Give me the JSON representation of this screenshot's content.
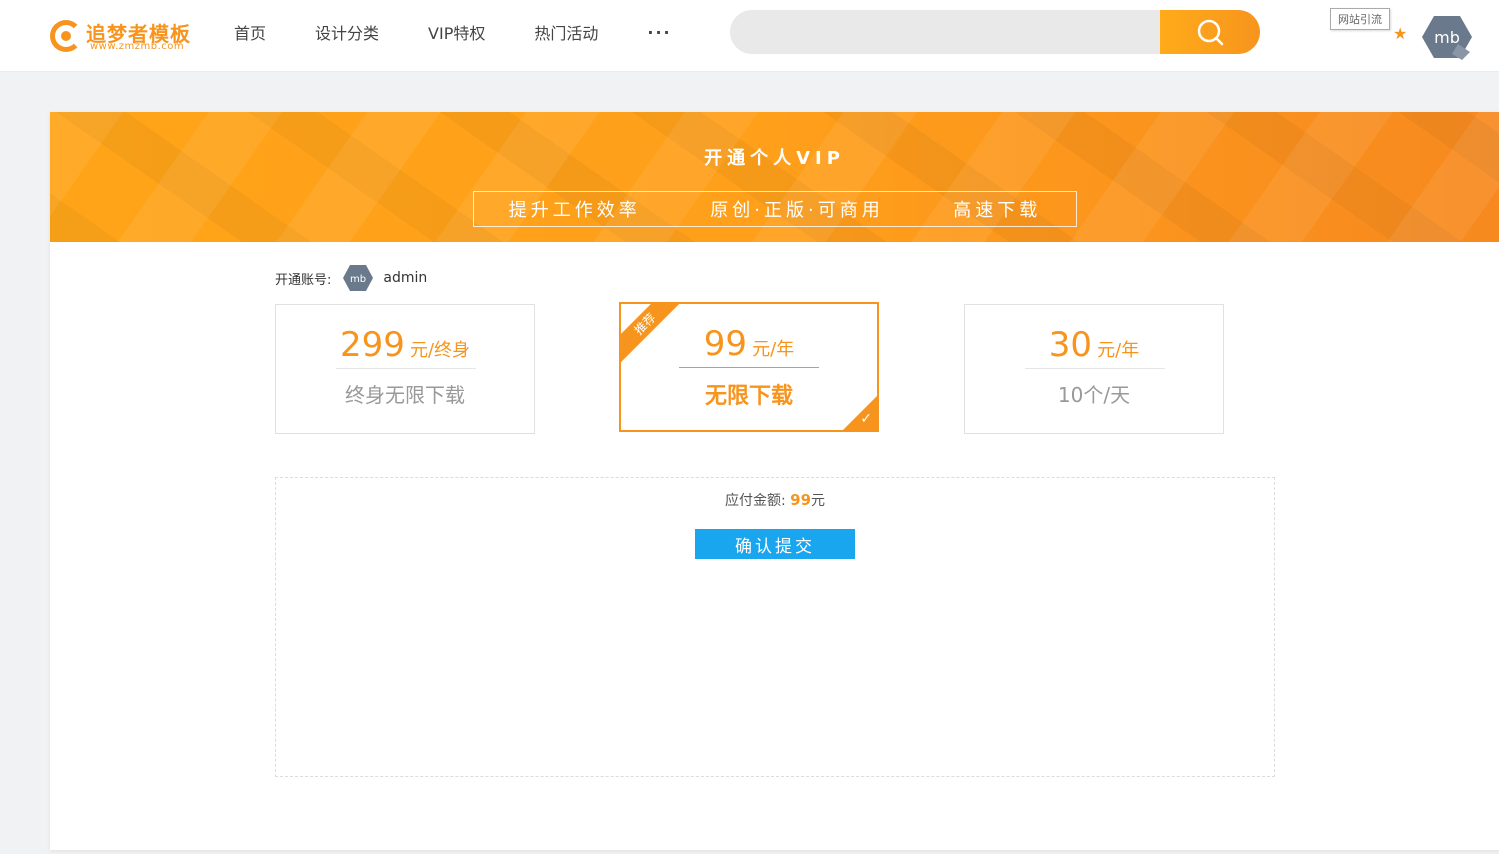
{
  "header": {
    "logo": {
      "name": "追梦者模板",
      "domain": "www.zmzmb.com"
    },
    "nav": [
      {
        "label": "首页"
      },
      {
        "label": "设计分类"
      },
      {
        "label": "VIP特权"
      },
      {
        "label": "热门活动"
      }
    ],
    "more_label": "···",
    "search": {
      "placeholder": "",
      "value": ""
    },
    "guide_badge": "网站引流",
    "icons": {
      "search": "search-icon",
      "star": "star-icon",
      "avatar": "avatar"
    }
  },
  "banner": {
    "title": "开通个人VIP",
    "features": [
      "提升工作效率",
      "原创·正版·可商用",
      "高速下载"
    ]
  },
  "account": {
    "label": "开通账号:",
    "username": "admin"
  },
  "plans": [
    {
      "price": "299",
      "unit": "元/终身",
      "desc": "终身无限下载",
      "selected": false
    },
    {
      "price": "99",
      "unit": "元/年",
      "desc": "无限下载",
      "selected": true,
      "ribbon": "推荐"
    },
    {
      "price": "30",
      "unit": "元/年",
      "desc": "10个/天",
      "selected": false
    }
  ],
  "payment": {
    "label": "应付金额:",
    "amount": "99",
    "currency": "元",
    "submit_label": "确认提交"
  },
  "colors": {
    "accent": "#f7941d",
    "submit": "#19a6ee"
  }
}
